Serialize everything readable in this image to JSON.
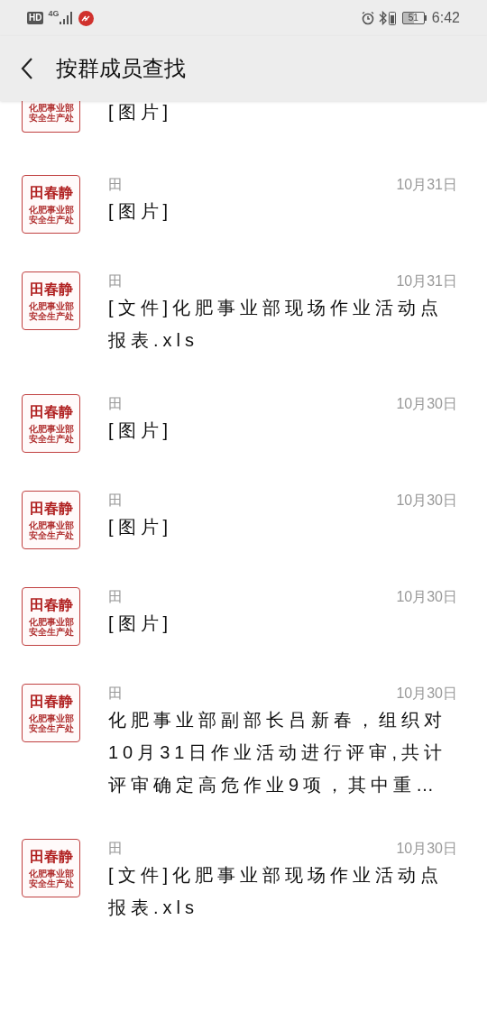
{
  "status_bar": {
    "hd": "HD",
    "network": "4G",
    "battery": "51",
    "time": "6:42"
  },
  "header": {
    "title": "按群成员查找"
  },
  "messages": [
    {
      "kind": "clipped",
      "avatar_caption": "化肥事业部安全生产处",
      "message": "[图片]"
    },
    {
      "kind": "full",
      "avatar_name": "田春静",
      "avatar_caption": "化肥事业部安全生产处",
      "sender": "田",
      "date": "10月31日",
      "message": "[图片]"
    },
    {
      "kind": "full",
      "avatar_name": "田春静",
      "avatar_caption": "化肥事业部安全生产处",
      "sender": "田",
      "date": "10月31日",
      "message": "[文件]化肥事业部现场作业活动点报表.xls"
    },
    {
      "kind": "full",
      "avatar_name": "田春静",
      "avatar_caption": "化肥事业部安全生产处",
      "sender": "田",
      "date": "10月30日",
      "message": "[图片]"
    },
    {
      "kind": "full",
      "avatar_name": "田春静",
      "avatar_caption": "化肥事业部安全生产处",
      "sender": "田",
      "date": "10月30日",
      "message": "[图片]"
    },
    {
      "kind": "full",
      "avatar_name": "田春静",
      "avatar_caption": "化肥事业部安全生产处",
      "sender": "田",
      "date": "10月30日",
      "message": "[图片]"
    },
    {
      "kind": "full",
      "avatar_name": "田春静",
      "avatar_caption": "化肥事业部安全生产处",
      "sender": "田",
      "date": "10月30日",
      "message": "化肥事业部副部长吕新春，组织对10月31日作业活动进行评审,共计评审确定高危作业9项，其中重…"
    },
    {
      "kind": "full",
      "avatar_name": "田春静",
      "avatar_caption": "化肥事业部安全生产处",
      "sender": "田",
      "date": "10月30日",
      "message": "[文件]化肥事业部现场作业活动点报表.xls"
    }
  ]
}
